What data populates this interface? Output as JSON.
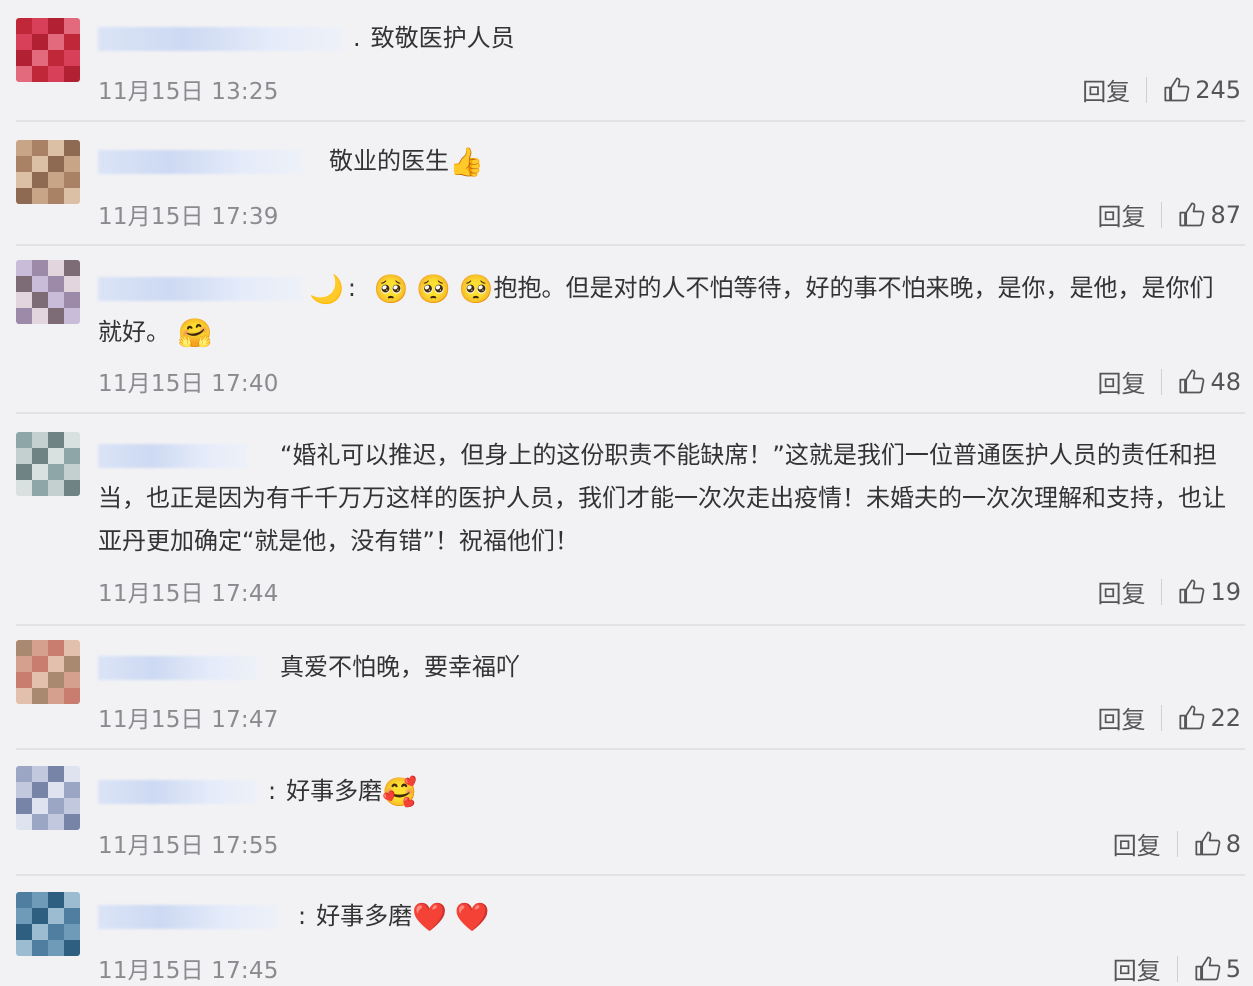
{
  "comments": [
    {
      "avatar_colors": [
        "#c0283a",
        "#d8405a",
        "#b22033",
        "#e26a7c"
      ],
      "text": "致敬医护人员",
      "emoji": [],
      "time": "11月15日 13:25",
      "reply_label": "回复",
      "likes": "245"
    },
    {
      "avatar_colors": [
        "#c9a587",
        "#a98266",
        "#dcc0a6",
        "#8f6a52"
      ],
      "text": "敬业的医生",
      "emoji": [
        "👍"
      ],
      "time": "11月15日 17:39",
      "reply_label": "回复",
      "likes": "87"
    },
    {
      "avatar_colors": [
        "#c9bcd9",
        "#9c8aa8",
        "#e3d5de",
        "#7d6b76"
      ],
      "text_before": "",
      "emoji_before": [
        "🥺",
        "🥺",
        "🥺"
      ],
      "text": "抱抱。但是对的人不怕等待，好的事不怕来晚，是你，是他，是你们就好。",
      "emoji": [
        "🤗"
      ],
      "time": "11月15日 17:40",
      "reply_label": "回复",
      "likes": "48"
    },
    {
      "avatar_colors": [
        "#8fa6a9",
        "#c4d0d0",
        "#6f8385",
        "#d9e0e0"
      ],
      "text": "“婚礼可以推迟，但身上的这份职责不能缺席！”这就是我们一位普通医护人员的责任和担当，也正是因为有千千万万这样的医护人员，我们才能一次次走出疫情！未婚夫的一次次理解和支持，也让亚丹更加确定“就是他，没有错”！祝福他们！",
      "emoji": [],
      "time": "11月15日 17:44",
      "reply_label": "回复",
      "likes": "19"
    },
    {
      "avatar_colors": [
        "#a9896f",
        "#d6a08e",
        "#c87d6e",
        "#e3c0ad"
      ],
      "text": "真爱不怕晚，要幸福吖",
      "emoji": [],
      "time": "11月15日 17:47",
      "reply_label": "回复",
      "likes": "22"
    },
    {
      "avatar_colors": [
        "#9aa6c4",
        "#c2c9de",
        "#7784a8",
        "#dfe3ef"
      ],
      "text": "好事多磨",
      "emoji": [
        "🥰"
      ],
      "time": "11月15日 17:55",
      "reply_label": "回复",
      "likes": "8"
    },
    {
      "avatar_colors": [
        "#4f7ea0",
        "#6f9bb9",
        "#2f5f80",
        "#9cbcd2"
      ],
      "text": "好事多磨",
      "emoji": [
        "❤️",
        "❤️"
      ],
      "time": "11月15日 17:45",
      "reply_label": "回复",
      "likes": "5"
    }
  ]
}
